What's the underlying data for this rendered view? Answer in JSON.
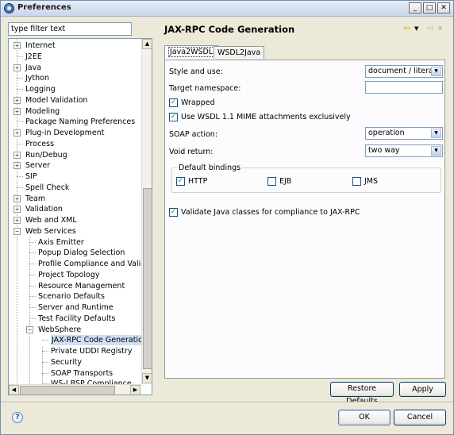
{
  "window": {
    "title": "Preferences",
    "controls": {
      "minimize": "_",
      "maximize": "□",
      "close": "✕"
    }
  },
  "filter": {
    "value": "type filter text"
  },
  "tree": {
    "items": [
      {
        "label": "Internet",
        "toggle": "+",
        "level": 0
      },
      {
        "label": "J2EE",
        "toggle": "",
        "level": 0
      },
      {
        "label": "Java",
        "toggle": "+",
        "level": 0
      },
      {
        "label": "Jython",
        "toggle": "",
        "level": 0
      },
      {
        "label": "Logging",
        "toggle": "",
        "level": 0
      },
      {
        "label": "Model Validation",
        "toggle": "+",
        "level": 0
      },
      {
        "label": "Modeling",
        "toggle": "+",
        "level": 0
      },
      {
        "label": "Package Naming Preferences",
        "toggle": "",
        "level": 0
      },
      {
        "label": "Plug-in Development",
        "toggle": "+",
        "level": 0
      },
      {
        "label": "Process",
        "toggle": "",
        "level": 0
      },
      {
        "label": "Run/Debug",
        "toggle": "+",
        "level": 0
      },
      {
        "label": "Server",
        "toggle": "+",
        "level": 0
      },
      {
        "label": "SIP",
        "toggle": "",
        "level": 0
      },
      {
        "label": "Spell Check",
        "toggle": "",
        "level": 0
      },
      {
        "label": "Team",
        "toggle": "+",
        "level": 0
      },
      {
        "label": "Validation",
        "toggle": "+",
        "level": 0
      },
      {
        "label": "Web and XML",
        "toggle": "+",
        "level": 0
      },
      {
        "label": "Web Services",
        "toggle": "−",
        "level": 0
      },
      {
        "label": "Axis Emitter",
        "toggle": "",
        "level": 1
      },
      {
        "label": "Popup Dialog Selection",
        "toggle": "",
        "level": 1
      },
      {
        "label": "Profile Compliance and Validatio",
        "toggle": "",
        "level": 1
      },
      {
        "label": "Project Topology",
        "toggle": "",
        "level": 1
      },
      {
        "label": "Resource Management",
        "toggle": "",
        "level": 1
      },
      {
        "label": "Scenario Defaults",
        "toggle": "",
        "level": 1
      },
      {
        "label": "Server and Runtime",
        "toggle": "",
        "level": 1
      },
      {
        "label": "Test Facility Defaults",
        "toggle": "",
        "level": 1
      },
      {
        "label": "WebSphere",
        "toggle": "−",
        "level": 1
      },
      {
        "label": "JAX-RPC Code Generation",
        "toggle": "",
        "level": 2,
        "selected": true
      },
      {
        "label": "Private UDDI Registry",
        "toggle": "",
        "level": 2
      },
      {
        "label": "Security",
        "toggle": "",
        "level": 2
      },
      {
        "label": "SOAP Transports",
        "toggle": "",
        "level": 2
      },
      {
        "label": "WS-I BSP Compliance",
        "toggle": "",
        "level": 2
      }
    ]
  },
  "page": {
    "title": "JAX-RPC Code Generation",
    "tabs": [
      "Java2WSDL",
      "WSDL2Java"
    ],
    "style_label": "Style and use:",
    "style_value": "document / literal",
    "namespace_label": "Target namespace:",
    "namespace_value": "",
    "wrapped_label": "Wrapped",
    "mime_label": "Use WSDL 1.1 MIME attachments exclusively",
    "soap_action_label": "SOAP action:",
    "soap_action_value": "operation",
    "void_return_label": "Void return:",
    "void_return_value": "two way",
    "bindings_label": "Default bindings",
    "binding_http": "HTTP",
    "binding_ejb": "EJB",
    "binding_jms": "JMS",
    "validate_label": "Validate Java classes for compliance to JAX-RPC",
    "restore_defaults": "Restore Defaults",
    "apply": "Apply"
  },
  "footer": {
    "ok": "OK",
    "cancel": "Cancel"
  }
}
